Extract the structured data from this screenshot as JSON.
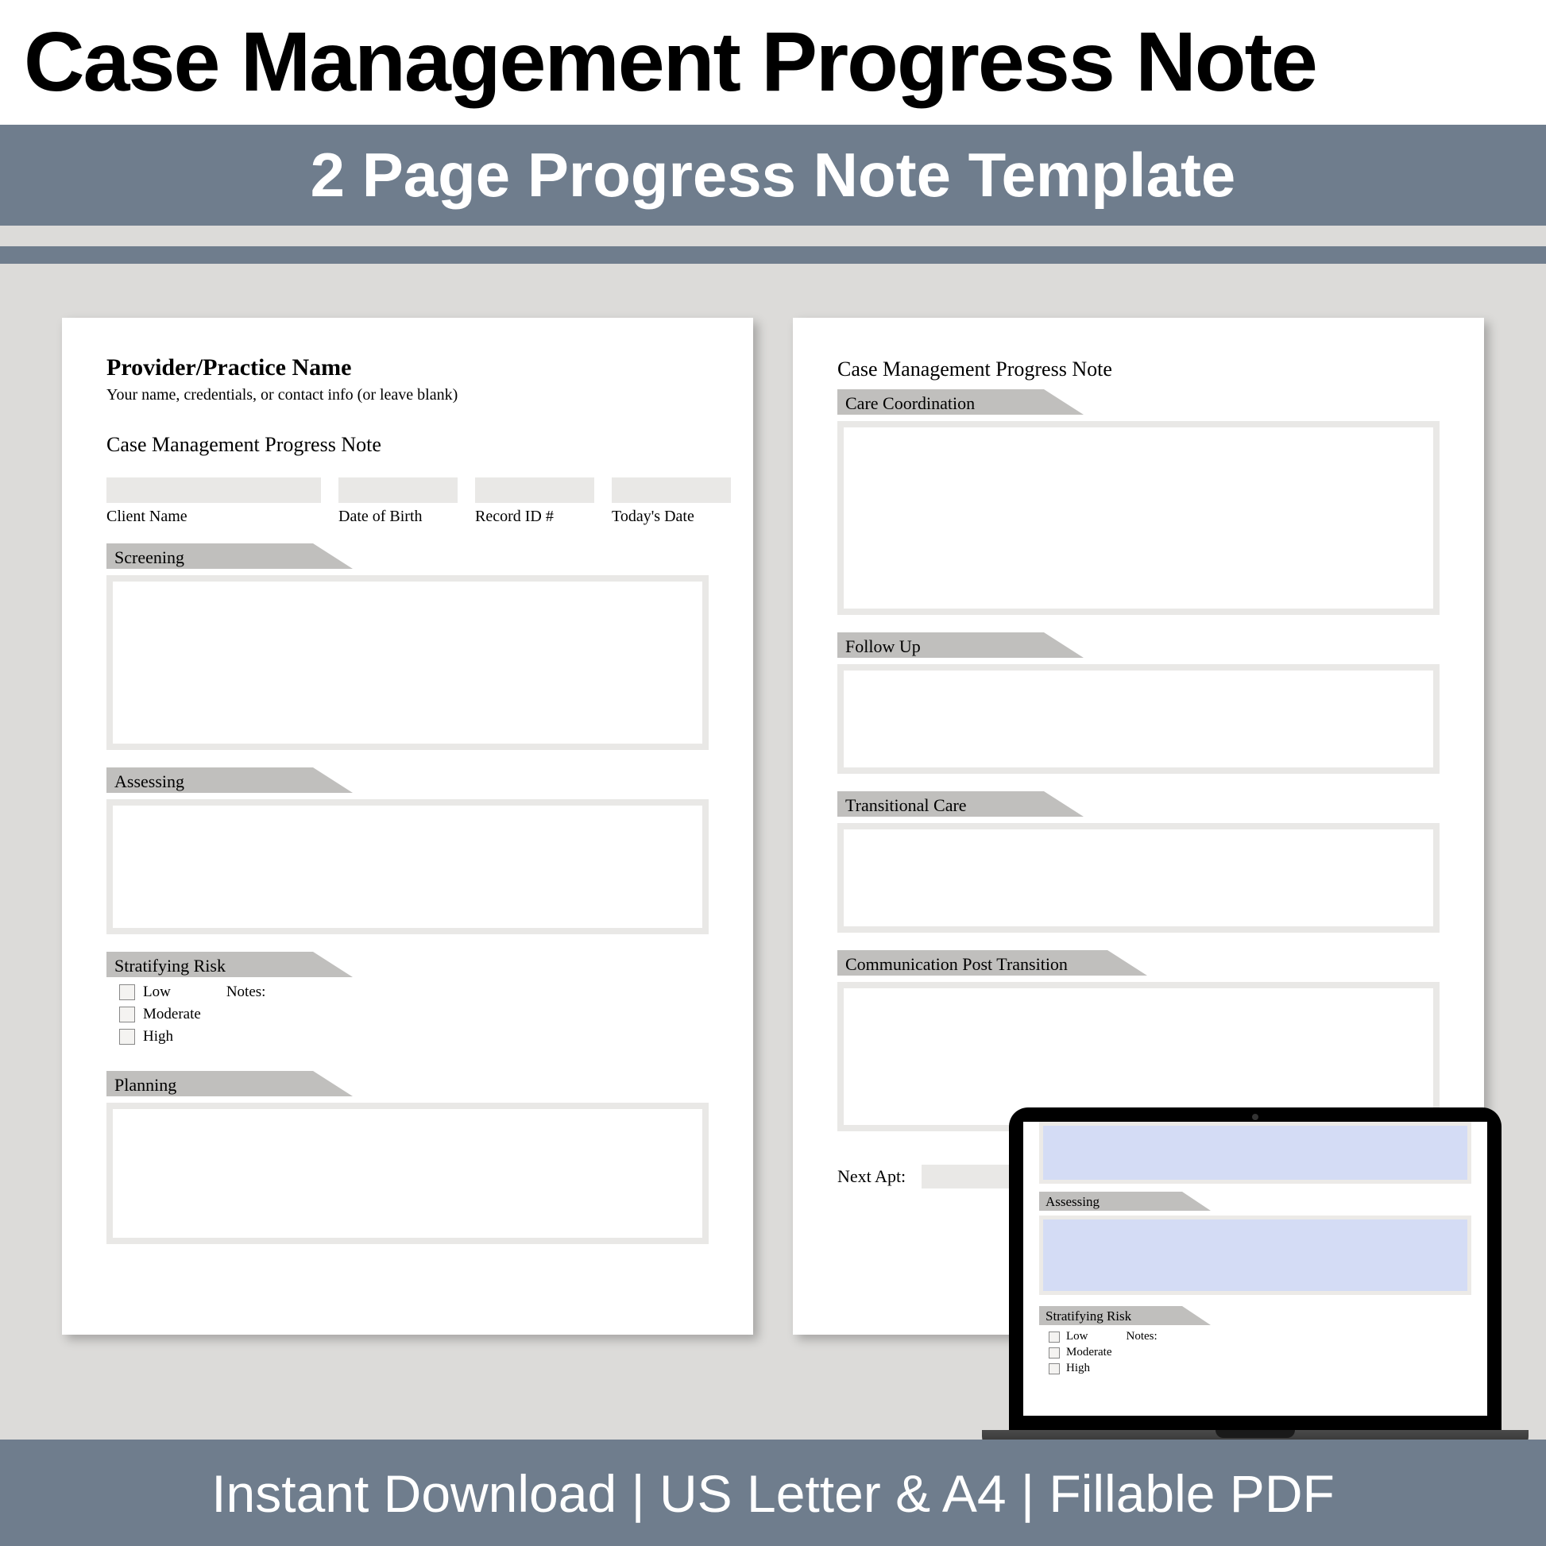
{
  "header": {
    "title": "Case Management Progress Note",
    "subtitle": "2 Page Progress Note Template"
  },
  "footer": "Instant Download | US Letter & A4 | Fillable PDF",
  "page1": {
    "provider_name": "Provider/Practice Name",
    "provider_sub": "Your name, credentials, or contact info (or leave blank)",
    "doc_title": "Case Management Progress Note",
    "fields": {
      "client_name": "Client Name",
      "dob": "Date of Birth",
      "record_id": "Record ID #",
      "todays_date": "Today's Date"
    },
    "sections": {
      "screening": "Screening",
      "assessing": "Assessing",
      "stratifying": "Stratifying Risk",
      "planning": "Planning"
    },
    "risk": {
      "low": "Low",
      "moderate": "Moderate",
      "high": "High",
      "notes": "Notes:"
    }
  },
  "page2": {
    "doc_title": "Case Management Progress Note",
    "sections": {
      "care_coordination": "Care Coordination",
      "follow_up": "Follow Up",
      "transitional": "Transitional Care",
      "communication": "Communication Post Transition"
    },
    "next_apt": "Next Apt:"
  },
  "laptop": {
    "assessing": "Assessing",
    "stratifying": "Stratifying Risk",
    "risk": {
      "low": "Low",
      "moderate": "Moderate",
      "high": "High",
      "notes": "Notes:"
    }
  }
}
